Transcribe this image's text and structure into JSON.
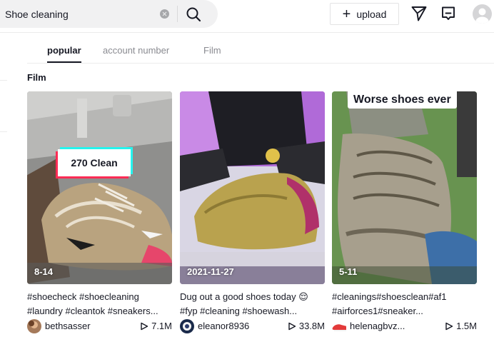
{
  "search": {
    "value": "Shoe cleaning",
    "placeholder": ""
  },
  "header": {
    "upload_plus": "+",
    "upload_label": "upload"
  },
  "tabs": [
    {
      "label": "popular",
      "active": true
    },
    {
      "label": "account number",
      "active": false
    },
    {
      "label": "Film",
      "active": false
    }
  ],
  "section_title": "Film",
  "videos": [
    {
      "overlay_text": "270 Clean",
      "date": "8-14",
      "desc_line1": "#shoecheck #shoecleaning",
      "desc_line2": "#laundry #cleantok #sneakers...",
      "username": "bethsasser",
      "views": "7.1M"
    },
    {
      "overlay_text": "",
      "date": "2021-11-27",
      "desc_line1": "Dug out a good shoes today 😌",
      "desc_line2": "#fyp #cleaning #shoewash...",
      "username": "eleanor8936",
      "views": "33.8M"
    },
    {
      "overlay_text": "Worse shoes ever",
      "date": "5-11",
      "desc_line1": "#cleanings#shoesclean#af1",
      "desc_line2": "#airforces1#sneaker...",
      "username": "helenagbvz...",
      "views": "1.5M"
    }
  ],
  "colors": {
    "accent_cyan": "#25f4ee",
    "accent_red": "#fe2c55",
    "text": "#161823",
    "muted": "#8a8b91"
  },
  "icons": [
    "clear-icon",
    "search-icon",
    "plus-icon",
    "send-icon",
    "inbox-icon",
    "play-icon",
    "avatar"
  ]
}
